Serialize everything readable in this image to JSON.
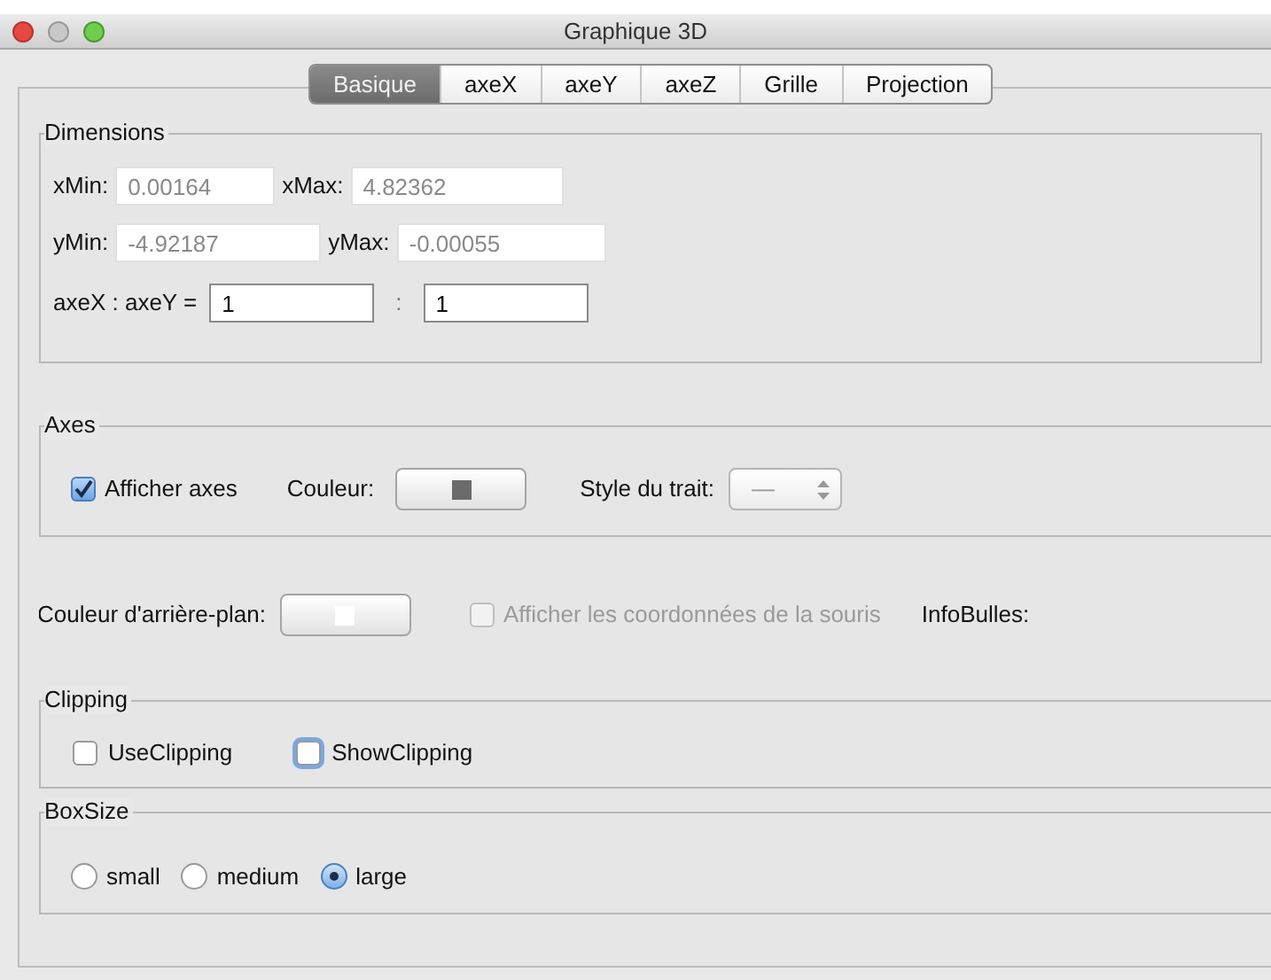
{
  "window": {
    "title": "Graphique 3D"
  },
  "tabs": [
    {
      "label": "Basique",
      "selected": true
    },
    {
      "label": "axeX",
      "selected": false
    },
    {
      "label": "axeY",
      "selected": false
    },
    {
      "label": "axeZ",
      "selected": false
    },
    {
      "label": "Grille",
      "selected": false
    },
    {
      "label": "Projection",
      "selected": false
    }
  ],
  "dimensions": {
    "title": "Dimensions",
    "rows": [
      [
        {
          "label": "xMin:",
          "value": "0.00164",
          "disabled": true
        },
        {
          "label": "xMax:",
          "value": "4.82362",
          "disabled": true
        }
      ],
      [
        {
          "label": "yMin:",
          "value": "-4.92187",
          "disabled": true
        },
        {
          "label": "yMax:",
          "value": "-0.00055",
          "disabled": true
        }
      ]
    ],
    "ratio": {
      "label": "axeX : axeY =",
      "x": {
        "value": "1",
        "disabled": false
      },
      "separator": ":",
      "y": {
        "value": "1",
        "disabled": false
      }
    }
  },
  "axes": {
    "title": "Axes",
    "show_axes": {
      "label": "Afficher axes",
      "checked": true,
      "disabled": false
    },
    "color_label": "Couleur:",
    "color": "#6b6b6b",
    "line_style_label": "Style du trait:",
    "line_style": "—"
  },
  "background": {
    "label": "Couleur d'arrière-plan:",
    "color": "#ffffff",
    "mouse_coords": {
      "label": "Afficher les coordonnées de la souris",
      "checked": false,
      "disabled": true
    },
    "tooltips_label": "InfoBulles:"
  },
  "clipping": {
    "title": "Clipping",
    "options": [
      {
        "label": "UseClipping",
        "checked": false,
        "focused": false
      },
      {
        "label": "ShowClipping",
        "checked": false,
        "focused": true
      }
    ]
  },
  "box_size": {
    "title": "BoxSize",
    "options": [
      {
        "label": "small",
        "selected": false
      },
      {
        "label": "medium",
        "selected": false
      },
      {
        "label": "large",
        "selected": true
      }
    ]
  }
}
